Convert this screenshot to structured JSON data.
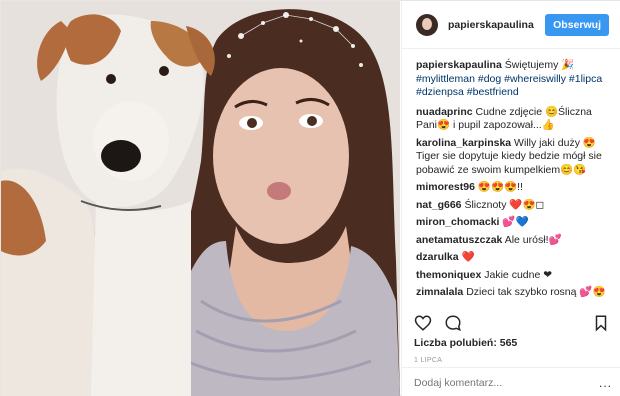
{
  "post": {
    "username": "papierskapaulina",
    "follow_label": "Obserwuj",
    "caption_user": "papierskapaulina",
    "caption_text": " Świętujemy 🎉",
    "caption_tags": "#mylittleman #dog #whereiswilly #1lipca #dzienpsa #bestfriend"
  },
  "comments": [
    {
      "user": "nuadaprinc",
      "text": " Cudne zdjęcie 😊Śliczna Pani😍 i pupil zapozował...👍"
    },
    {
      "user": "karolina_karpinska",
      "text": " Willy jaki duży 😍Tiger sie dopytuje kiedy bedzie mógł sie pobawić ze swoim kumpelkiem😊😘"
    },
    {
      "user": "mimorest96",
      "text": " 😍😍😍!!"
    },
    {
      "user": "nat_g666",
      "text": " Ślicznoty ❤️😍◻"
    },
    {
      "user": "miron_chomacki",
      "text": " 💕💙"
    },
    {
      "user": "anetamatuszczak",
      "text": " Ale urósł!💕"
    },
    {
      "user": "dzarulka",
      "text": " ❤️"
    },
    {
      "user": "themoniquex",
      "text": " Jakie cudne ❤"
    },
    {
      "user": "zimnalala",
      "text": " Dzieci tak szybko rosną 💕😍"
    }
  ],
  "footer": {
    "likes": "Liczba polubień: 565",
    "date": "1 LIPCA",
    "add_comment_placeholder": "Dodaj komentarz...",
    "more_label": "..."
  },
  "icons": {
    "like": "heart-icon",
    "comment": "comment-icon",
    "save": "bookmark-icon",
    "options": "more-options-icon"
  },
  "colors": {
    "follow_button": "#3897f0",
    "hashtag": "#003569",
    "date": "#999999"
  }
}
